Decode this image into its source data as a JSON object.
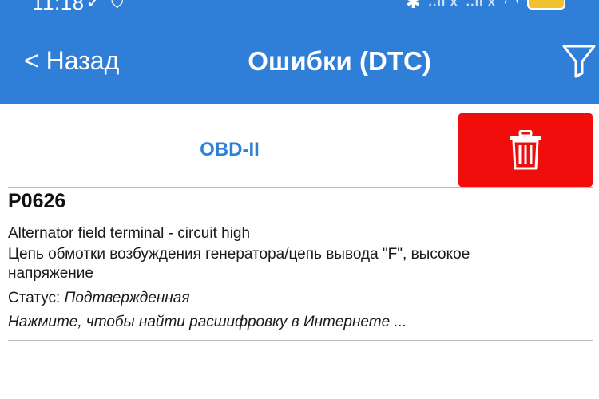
{
  "status_bar": {
    "time": "11:18",
    "signal_1": "..ll x",
    "signal_2": "..ll x",
    "battery_color": "#f2c12e"
  },
  "header": {
    "back_label": "< Назад",
    "title": "Ошибки (DTC)",
    "background_color": "#2f7fd9"
  },
  "tabs": {
    "obd_label": "OBD-II"
  },
  "delete_button": {
    "color": "#f20d0d",
    "icon": "trash-icon"
  },
  "dtc_list": [
    {
      "code": "P0626",
      "description_en": "Alternator field terminal - circuit high",
      "description_ru_line1": "Цепь обмотки возбуждения генератора/цепь вывода \"F\", высокое",
      "description_ru_line2": "напряжение",
      "status_label": "Статус: ",
      "status_value": "Подтвержденная",
      "search_hint": "Нажмите, чтобы найти расшифровку в Интернете ..."
    }
  ]
}
